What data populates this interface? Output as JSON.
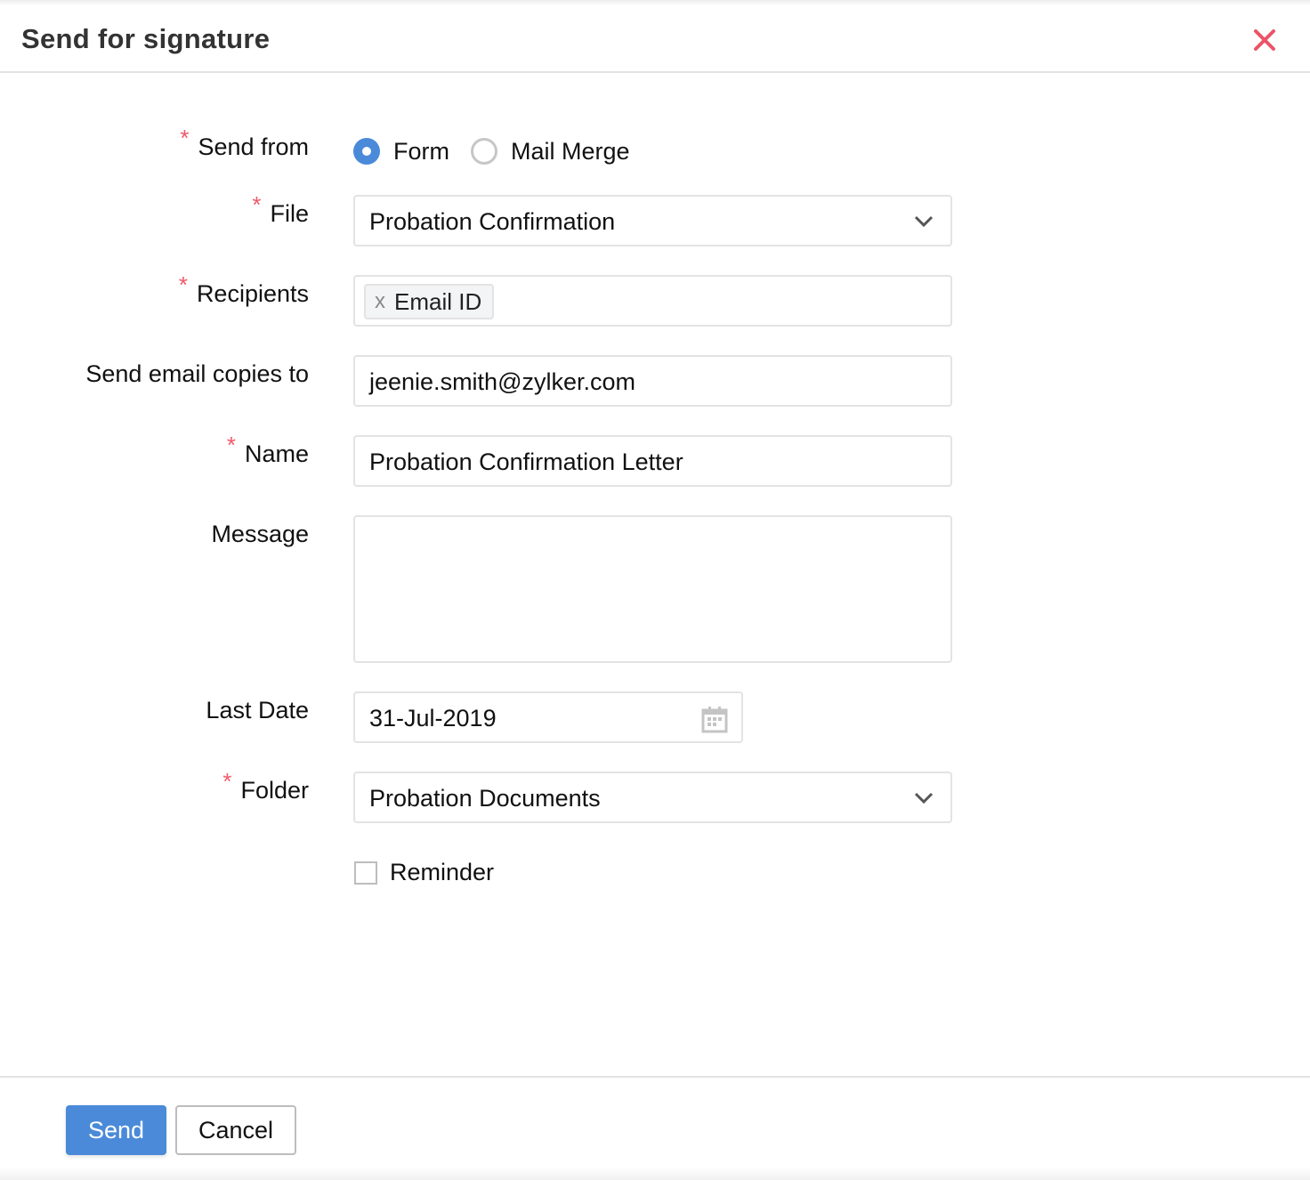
{
  "dialog": {
    "title": "Send for signature",
    "close_icon": "close-x-icon",
    "accent_color": "#4a8ad9",
    "required_color": "#f0596a",
    "close_color": "#eb5468"
  },
  "form": {
    "required_marker": "*",
    "send_from": {
      "label": "Send from",
      "required": true,
      "options": [
        {
          "label": "Form",
          "selected": true
        },
        {
          "label": "Mail Merge",
          "selected": false
        }
      ]
    },
    "file": {
      "label": "File",
      "required": true,
      "value": "Probation Confirmation",
      "icon": "chevron-down-icon"
    },
    "recipients": {
      "label": "Recipients",
      "required": true,
      "chips": [
        {
          "remove": "x",
          "label": "Email ID"
        }
      ]
    },
    "email_copies": {
      "label": "Send email copies to",
      "required": false,
      "value": "jeenie.smith@zylker.com"
    },
    "name": {
      "label": "Name",
      "required": true,
      "value": "Probation Confirmation Letter"
    },
    "message": {
      "label": "Message",
      "required": false,
      "value": ""
    },
    "last_date": {
      "label": "Last Date",
      "required": false,
      "value": "31-Jul-2019",
      "icon": "calendar-icon"
    },
    "folder": {
      "label": "Folder",
      "required": true,
      "value": "Probation Documents",
      "icon": "chevron-down-icon"
    },
    "reminder": {
      "label": "Reminder",
      "checked": false
    }
  },
  "footer": {
    "send_label": "Send",
    "cancel_label": "Cancel"
  }
}
